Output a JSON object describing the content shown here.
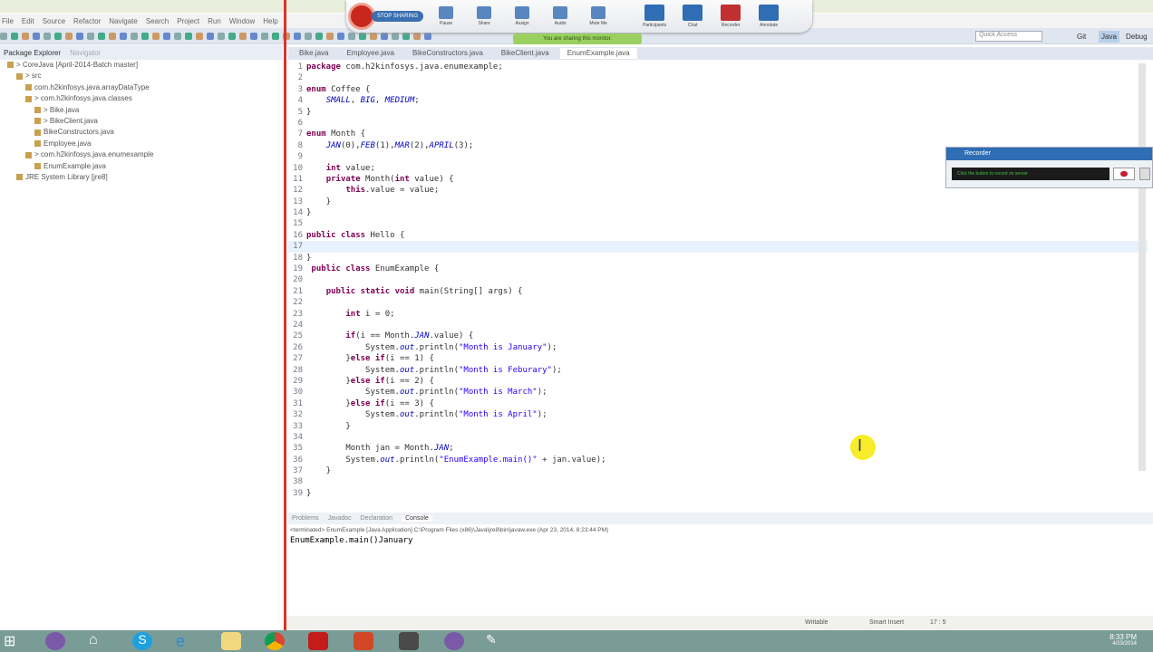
{
  "menu": [
    "File",
    "Edit",
    "Source",
    "Refactor",
    "Navigate",
    "Search",
    "Project",
    "Run",
    "Window",
    "Help"
  ],
  "quick_access": "Quick Access",
  "perspectives": [
    "Git",
    "Java",
    "Debug"
  ],
  "package_explorer": {
    "tab": "Package Explorer",
    "tab2": "Navigator",
    "tree": [
      {
        "label": "> CoreJava [April-2014-Batch master]",
        "depth": 0
      },
      {
        "label": "> src",
        "depth": 1
      },
      {
        "label": "com.h2kinfosys.java.arrayDataType",
        "depth": 2
      },
      {
        "label": "> com.h2kinfosys.java.classes",
        "depth": 2
      },
      {
        "label": "> Bike.java",
        "depth": 3
      },
      {
        "label": "> BikeClient.java",
        "depth": 3
      },
      {
        "label": "BikeConstructors.java",
        "depth": 3
      },
      {
        "label": "Employee.java",
        "depth": 3
      },
      {
        "label": "> com.h2kinfosys.java.enumexample",
        "depth": 2
      },
      {
        "label": "EnumExample.java",
        "depth": 3
      },
      {
        "label": "JRE System Library [jre8]",
        "depth": 1
      }
    ]
  },
  "editor_tabs": [
    "Bike.java",
    "Employee.java",
    "BikeConstructors.java",
    "BikeClient.java",
    "EnumExample.java"
  ],
  "code": [
    "package com.h2kinfosys.java.enumexample;",
    "",
    "enum Coffee {",
    "    SMALL, BIG, MEDIUM;",
    "}",
    "",
    "enum Month {",
    "    JAN(0),FEB(1),MAR(2),APRIL(3);",
    "",
    "    int value;",
    "    private Month(int value) {",
    "        this.value = value;",
    "    }",
    "}",
    "",
    "public class Hello {",
    "",
    "}",
    " public class EnumExample {",
    "",
    "    public static void main(String[] args) {",
    "",
    "        int i = 0;",
    "",
    "        if(i == Month.JAN.value) {",
    "            System.out.println(\"Month is January\");",
    "        }else if(i == 1) {",
    "            System.out.println(\"Month is Feburary\");",
    "        }else if(i == 2) {",
    "            System.out.println(\"Month is March\");",
    "        }else if(i == 3) {",
    "            System.out.println(\"Month is April\");",
    "        }",
    "",
    "        Month jan = Month.JAN;",
    "        System.out.println(\"EnumExample.main()\" + jan.value);",
    "    }",
    "",
    "}"
  ],
  "current_line": 17,
  "share_toolbar": {
    "stop": "STOP SHARING",
    "buttons": [
      "Pause",
      "Share",
      "Assign",
      "Audio",
      "Mute Me"
    ],
    "right": [
      "Participants",
      "Chat",
      "Recorder",
      "Annotate"
    ],
    "note": "You are sharing this monitor."
  },
  "recorder": {
    "title": "Recorder",
    "message": "Click the button to record on server"
  },
  "console": {
    "tabs": [
      "Problems",
      "Javadoc",
      "Declaration",
      "Console"
    ],
    "status": "<terminated> EnumExample [Java Application] C:\\Program Files (x86)\\Java\\jre8\\bin\\javaw.exe (Apr 23, 2014, 8:23:44 PM)",
    "output": "EnumExample.main()January"
  },
  "status": {
    "writable": "Writable",
    "insert": "Smart Insert",
    "position": "17 : 5"
  },
  "clock": {
    "time": "8:33 PM",
    "date": "4/23/2014"
  }
}
